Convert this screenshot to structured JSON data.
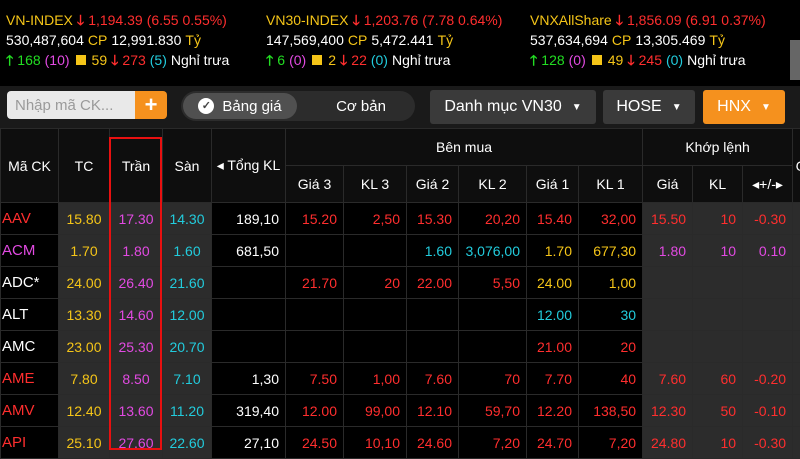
{
  "indices": [
    {
      "name": "VN-INDEX",
      "value": "1,194.39",
      "change": "(6.55 0.55%)",
      "volume": "530,487,604",
      "cp_label": "CP",
      "cp_value": "12,991.830",
      "unit": "Tỷ",
      "up": "168",
      "up_ceil": "(10)",
      "flat": "59",
      "down": "273",
      "down_floor": "(5)",
      "status": "Nghỉ trưa"
    },
    {
      "name": "VN30-INDEX",
      "value": "1,203.76",
      "change": "(7.78 0.64%)",
      "volume": "147,569,400",
      "cp_label": "CP",
      "cp_value": "5,472.441",
      "unit": "Tỷ",
      "up": "6",
      "up_ceil": "(0)",
      "flat": "2",
      "down": "22",
      "down_floor": "(0)",
      "status": "Nghỉ trưa"
    },
    {
      "name": "VNXAllShare",
      "value": "1,856.09",
      "change": "(6.91 0.37%)",
      "volume": "537,634,694",
      "cp_label": "CP",
      "cp_value": "13,305.469",
      "unit": "Tỷ",
      "up": "128",
      "up_ceil": "(0)",
      "flat": "49",
      "down": "245",
      "down_floor": "(0)",
      "status": "Nghỉ trưa"
    }
  ],
  "toolbar": {
    "search_placeholder": "Nhập mã CK...",
    "add_icon": "plus-icon",
    "toggle_on": "Bảng giá",
    "toggle_off": "Cơ bản",
    "watchlist": "Danh mục VN30",
    "exchange1": "HOSE",
    "exchange2": "HNX"
  },
  "headers": {
    "symbol": "Mã CK",
    "ref": "TC",
    "ceil": "Trần",
    "floor": "Sàn",
    "total": "◂ Tổng KL",
    "bid_group": "Bên mua",
    "match_group": "Khớp lệnh",
    "g3": "Giá 3",
    "k3": "KL 3",
    "g2": "Giá 2",
    "k2": "KL 2",
    "g1": "Giá 1",
    "k1": "KL 1",
    "mprice": "Giá",
    "mvol": "KL",
    "mchg": "◂+/-▸",
    "extra": "G"
  },
  "colors": {
    "ceiling": "#e24ae2",
    "reference": "#f5c518",
    "floor": "#22ccdd",
    "up": "#22dd22",
    "down": "#ff2e2e",
    "accent": "#f5911e"
  },
  "rows": [
    {
      "sym": "AAV",
      "symc": "red",
      "tc": "15.80",
      "tran": "17.30",
      "san": "14.30",
      "total": "189,10",
      "g3": "15.20",
      "g3c": "red",
      "k3": "2,50",
      "k3c": "red",
      "g2": "15.30",
      "g2c": "red",
      "k2": "20,20",
      "k2c": "red",
      "g1": "15.40",
      "g1c": "red",
      "k1": "32,00",
      "k1c": "red",
      "mp": "15.50",
      "mpc": "red",
      "mv": "10",
      "mvc": "red",
      "mc": "-0.30",
      "mcc": "red"
    },
    {
      "sym": "ACM",
      "symc": "purple",
      "tc": "1.70",
      "tran": "1.80",
      "san": "1.60",
      "total": "681,50",
      "g3": "",
      "g3c": "white",
      "k3": "",
      "k3c": "white",
      "g2": "1.60",
      "g2c": "cyan",
      "k2": "3,076,00",
      "k2c": "cyan",
      "g1": "1.70",
      "g1c": "yellow",
      "k1": "677,30",
      "k1c": "yellow",
      "mp": "1.80",
      "mpc": "purple",
      "mv": "10",
      "mvc": "purple",
      "mc": "0.10",
      "mcc": "purple"
    },
    {
      "sym": "ADC*",
      "symc": "white",
      "tc": "24.00",
      "tran": "26.40",
      "san": "21.60",
      "total": "",
      "g3": "21.70",
      "g3c": "red",
      "k3": "20",
      "k3c": "red",
      "g2": "22.00",
      "g2c": "red",
      "k2": "5,50",
      "k2c": "red",
      "g1": "24.00",
      "g1c": "yellow",
      "k1": "1,00",
      "k1c": "yellow",
      "mp": "",
      "mpc": "white",
      "mv": "",
      "mvc": "white",
      "mc": "",
      "mcc": "white"
    },
    {
      "sym": "ALT",
      "symc": "white",
      "tc": "13.30",
      "tran": "14.60",
      "san": "12.00",
      "total": "",
      "g3": "",
      "g3c": "white",
      "k3": "",
      "k3c": "white",
      "g2": "",
      "g2c": "white",
      "k2": "",
      "k2c": "white",
      "g1": "12.00",
      "g1c": "cyan",
      "k1": "30",
      "k1c": "cyan",
      "mp": "",
      "mpc": "white",
      "mv": "",
      "mvc": "white",
      "mc": "",
      "mcc": "white"
    },
    {
      "sym": "AMC",
      "symc": "white",
      "tc": "23.00",
      "tran": "25.30",
      "san": "20.70",
      "total": "",
      "g3": "",
      "g3c": "white",
      "k3": "",
      "k3c": "white",
      "g2": "",
      "g2c": "white",
      "k2": "",
      "k2c": "white",
      "g1": "21.00",
      "g1c": "red",
      "k1": "20",
      "k1c": "red",
      "mp": "",
      "mpc": "white",
      "mv": "",
      "mvc": "white",
      "mc": "",
      "mcc": "white"
    },
    {
      "sym": "AME",
      "symc": "red",
      "tc": "7.80",
      "tran": "8.50",
      "san": "7.10",
      "total": "1,30",
      "g3": "7.50",
      "g3c": "red",
      "k3": "1,00",
      "k3c": "red",
      "g2": "7.60",
      "g2c": "red",
      "k2": "70",
      "k2c": "red",
      "g1": "7.70",
      "g1c": "red",
      "k1": "40",
      "k1c": "red",
      "mp": "7.60",
      "mpc": "red",
      "mv": "60",
      "mvc": "red",
      "mc": "-0.20",
      "mcc": "red"
    },
    {
      "sym": "AMV",
      "symc": "red",
      "tc": "12.40",
      "tran": "13.60",
      "san": "11.20",
      "total": "319,40",
      "g3": "12.00",
      "g3c": "red",
      "k3": "99,00",
      "k3c": "red",
      "g2": "12.10",
      "g2c": "red",
      "k2": "59,70",
      "k2c": "red",
      "g1": "12.20",
      "g1c": "red",
      "k1": "138,50",
      "k1c": "red",
      "mp": "12.30",
      "mpc": "red",
      "mv": "50",
      "mvc": "red",
      "mc": "-0.10",
      "mcc": "red"
    },
    {
      "sym": "API",
      "symc": "red",
      "tc": "25.10",
      "tran": "27.60",
      "san": "22.60",
      "total": "27,10",
      "g3": "24.50",
      "g3c": "red",
      "k3": "10,10",
      "k3c": "red",
      "g2": "24.60",
      "g2c": "red",
      "k2": "7,20",
      "k2c": "red",
      "g1": "24.70",
      "g1c": "red",
      "k1": "7,20",
      "k1c": "red",
      "mp": "24.80",
      "mpc": "red",
      "mv": "10",
      "mvc": "red",
      "mc": "-0.30",
      "mcc": "red"
    }
  ]
}
